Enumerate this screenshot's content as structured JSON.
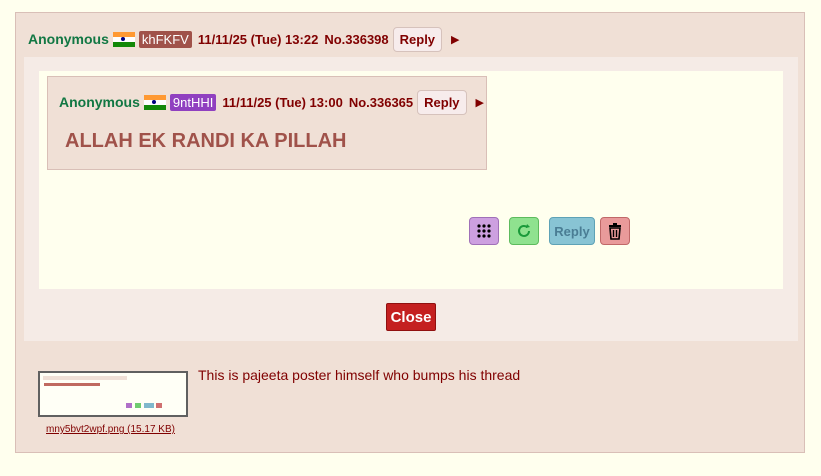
{
  "post": {
    "name": "Anonymous",
    "poster_id": "khFKFV",
    "poster_id_color": "#a0524a",
    "datetime": "11/11/25 (Tue) 13:22",
    "post_no": "No.336398",
    "reply_label": "Reply",
    "comment": "This is pajeeta poster himself who bumps his thread",
    "file_name": "mny5bvt2wpf.png (15.17 KB)"
  },
  "quoted_post": {
    "name": "Anonymous",
    "poster_id": "9ntHHI",
    "poster_id_color": "#9040c0",
    "datetime": "11/11/25 (Tue) 13:00",
    "post_no": "No.336365",
    "reply_label": "Reply",
    "body": "ALLAH EK RANDI KA PILLAH"
  },
  "tools": {
    "grid_icon": "dots-grid-icon",
    "refresh_icon": "refresh-icon",
    "reply_label": "Reply",
    "trash_icon": "trash-icon"
  },
  "close_label": "Close",
  "colors": {
    "name": "#117743",
    "text": "#800000",
    "post_bg": "#f0e0d6",
    "page_bg": "#ffffee"
  }
}
